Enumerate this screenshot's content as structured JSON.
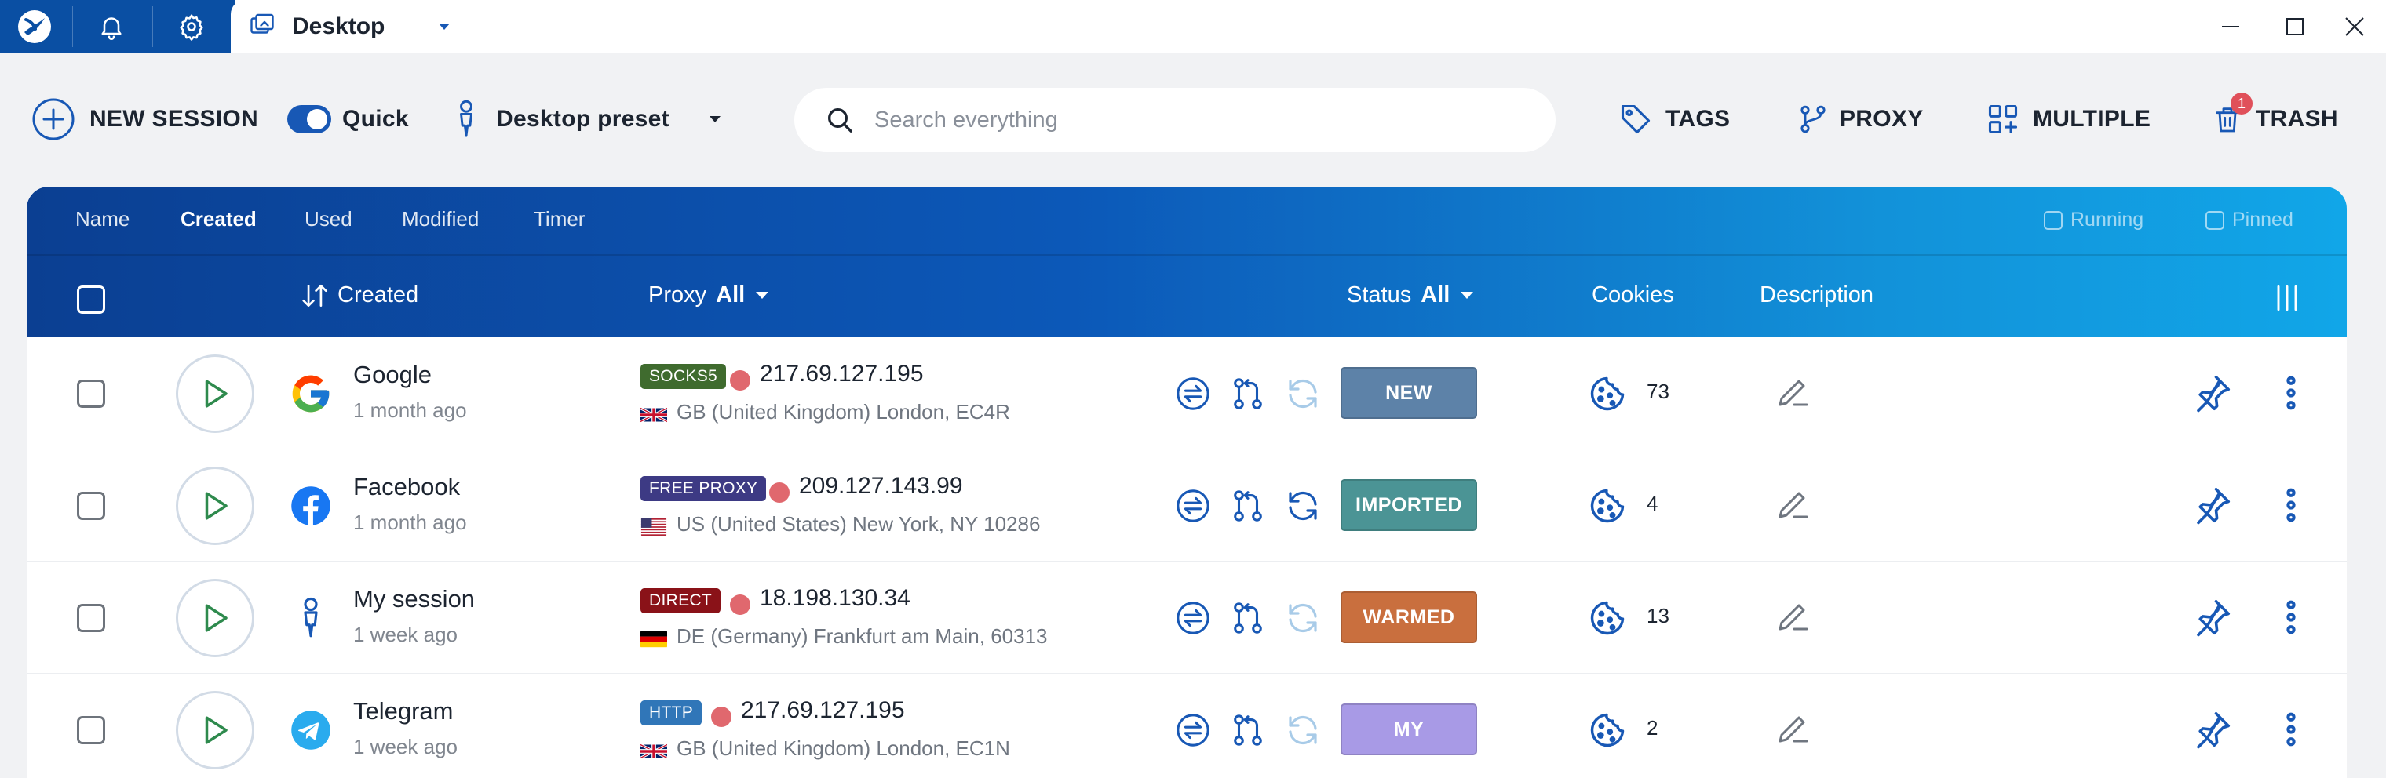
{
  "titlebar": {
    "tab_title": "Desktop",
    "icons": [
      "app-logo-icon",
      "bell-icon",
      "gear-icon",
      "desktop-tab-icon",
      "chevron-down-icon",
      "minimize-icon",
      "maximize-icon",
      "close-icon"
    ]
  },
  "toolbar": {
    "new_session": "NEW SESSION",
    "quick": "Quick",
    "quick_enabled": true,
    "preset": "Desktop preset",
    "search_placeholder": "Search everything",
    "tags": "TAGS",
    "proxy": "PROXY",
    "multiple": "MULTIPLE",
    "trash": "TRASH",
    "trash_badge": "1"
  },
  "table": {
    "sort_tabs": [
      "Name",
      "Created",
      "Used",
      "Modified",
      "Timer"
    ],
    "active_sort": "Created",
    "filters": [
      "Running",
      "Pinned"
    ],
    "columns": {
      "created": "Created",
      "proxy": "Proxy",
      "proxy_filter": "All",
      "status": "Status",
      "status_filter": "All",
      "cookies": "Cookies",
      "description": "Description"
    },
    "rows": [
      {
        "name": "Google",
        "created": "1 month ago",
        "icon": "google-icon",
        "proxy_type": "SOCKS5",
        "proxy_type_color": "#3f6b2e",
        "ip": "217.69.127.195",
        "flag": "gb",
        "location": "GB (United Kingdom) London, EC4R",
        "refresh_active": false,
        "status": "NEW",
        "status_color": "#5d82a8",
        "cookies": "73"
      },
      {
        "name": "Facebook",
        "created": "1 month ago",
        "icon": "facebook-icon",
        "proxy_type": "FREE PROXY",
        "proxy_type_color": "#3d3a84",
        "ip": "209.127.143.99",
        "flag": "us",
        "location": "US (United States) New York, NY 10286",
        "refresh_active": true,
        "status": "IMPORTED",
        "status_color": "#4b9495",
        "cookies": "4"
      },
      {
        "name": "My session",
        "created": "1 week ago",
        "icon": "user-icon",
        "proxy_type": "DIRECT",
        "proxy_type_color": "#8a1218",
        "ip": "18.198.130.34",
        "flag": "de",
        "location": "DE (Germany) Frankfurt am Main, 60313",
        "refresh_active": false,
        "status": "WARMED",
        "status_color": "#c96f3e",
        "cookies": "13"
      },
      {
        "name": "Telegram",
        "created": "1 week ago",
        "icon": "telegram-icon",
        "proxy_type": "HTTP",
        "proxy_type_color": "#3076b8",
        "ip": "217.69.127.195",
        "flag": "gb",
        "location": "GB (United Kingdom) London, EC1N",
        "refresh_active": false,
        "status": "MY",
        "status_color": "#a89ae6",
        "cookies": "2"
      }
    ]
  }
}
